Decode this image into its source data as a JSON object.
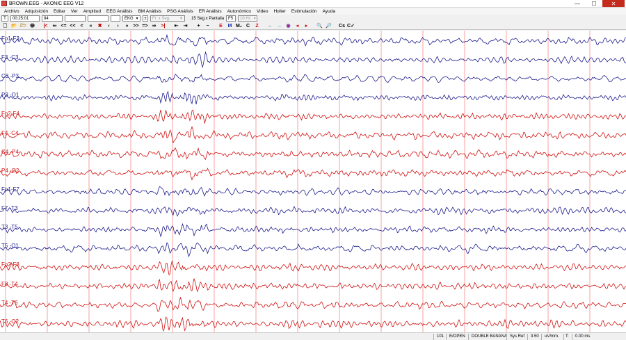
{
  "window": {
    "title": "BROWN.EEG - AKONIC EEG V12",
    "controls": {
      "minimize": "—",
      "maximize": "☐",
      "close": "✕"
    }
  },
  "menu": [
    "Archivo",
    "Adquisición",
    "Editar",
    "Ver",
    "Amplitud",
    "EEG Análisis",
    "BM Análisis",
    "PSG Análisis",
    "ER Análisis",
    "Autonómico",
    "Video",
    "Holter",
    "Estimulación",
    "Ayuda"
  ],
  "toolbar1": {
    "t_button": "T",
    "time": "00:25:01",
    "page": "84",
    "blank1": "",
    "blank2": "",
    "ekg_select": "EKG",
    "filter_select": "Fr. x Seg.",
    "seg_label": "15 Seg.x Pantalla",
    "f5": "F5",
    "hz_select": "10 Hz"
  },
  "toolbar2_icons": [
    {
      "name": "new-file-icon",
      "glyph": "🗋",
      "color": "#333"
    },
    {
      "name": "open-folder-icon",
      "glyph": "📂",
      "color": "#b08020"
    },
    {
      "name": "folder-icon",
      "glyph": "🗁",
      "color": "#b08020"
    },
    {
      "name": "print-icon",
      "glyph": "🖶",
      "color": "#333"
    },
    {
      "name": "first-page-icon",
      "glyph": "|<",
      "color": "#c00000"
    },
    {
      "name": "fast-back-icon",
      "glyph": "⇐",
      "color": "#000"
    },
    {
      "name": "back-double-icon",
      "glyph": "<=",
      "color": "#000"
    },
    {
      "name": "back-small-icon",
      "glyph": "<<",
      "color": "#000"
    },
    {
      "name": "back-icon",
      "glyph": "<",
      "color": "#000"
    },
    {
      "name": "rewind-icon",
      "glyph": "«",
      "color": "#000"
    },
    {
      "name": "cancel-icon",
      "glyph": "✖",
      "color": "#c00000"
    },
    {
      "name": "step-back-icon",
      "glyph": "‹",
      "color": "#000"
    },
    {
      "name": "step-forward-icon",
      "glyph": "›",
      "color": "#000"
    },
    {
      "name": "forward-icon",
      "glyph": "»",
      "color": "#000"
    },
    {
      "name": "forward-small-icon",
      "glyph": ">>",
      "color": "#000"
    },
    {
      "name": "forward-double-icon",
      "glyph": "=>",
      "color": "#000"
    },
    {
      "name": "fast-forward-icon",
      "glyph": "⇒",
      "color": "#000"
    },
    {
      "name": "last-page-icon",
      "glyph": ">|",
      "color": "#c00000"
    },
    {
      "name": "zoom-prev-icon",
      "glyph": "⇤",
      "color": "#000"
    },
    {
      "name": "zoom-next-icon",
      "glyph": "⇥",
      "color": "#000"
    },
    {
      "name": "plus-icon",
      "glyph": "+",
      "color": "#000"
    },
    {
      "name": "minus-icon",
      "glyph": "−",
      "color": "#000"
    },
    {
      "name": "event-e-icon",
      "glyph": "E",
      "color": "#d01010"
    },
    {
      "name": "mark-m-icon",
      "glyph": "M",
      "color": "#2030b0"
    },
    {
      "name": "montage-icon",
      "glyph": "M₂",
      "color": "#000"
    },
    {
      "name": "c-icon",
      "glyph": "C",
      "color": "#000"
    },
    {
      "name": "z-icon",
      "glyph": "Z",
      "color": "#d01010"
    },
    {
      "name": "arrow-left-icon",
      "glyph": "←",
      "color": "#2050d0"
    },
    {
      "name": "arrow-right-icon",
      "glyph": "→",
      "color": "#2050d0"
    },
    {
      "name": "target-icon",
      "glyph": "◉",
      "color": "#8030a0"
    },
    {
      "name": "red-left-icon",
      "glyph": "◂",
      "color": "#d01010"
    },
    {
      "name": "red-right-icon",
      "glyph": "▸",
      "color": "#d01010"
    },
    {
      "name": "zoom-in-icon",
      "glyph": "🔍",
      "color": "#208040"
    },
    {
      "name": "zoom-out-icon",
      "glyph": "🔎",
      "color": "#208040"
    },
    {
      "name": "cs-icon",
      "glyph": "Cs",
      "color": "#000"
    },
    {
      "name": "check-icon",
      "glyph": "C✓",
      "color": "#000"
    }
  ],
  "channels": [
    {
      "label": "Fp1-F3",
      "color": "#1a1a8c"
    },
    {
      "label": "F3 -C3",
      "color": "#1a1a8c"
    },
    {
      "label": "C3 -P3",
      "color": "#1a1a8c"
    },
    {
      "label": "P3 -O1",
      "color": "#1a1a8c"
    },
    {
      "label": "Fp2-F4",
      "color": "#d01010"
    },
    {
      "label": "F4 -C4",
      "color": "#d01010"
    },
    {
      "label": "C4 -P4",
      "color": "#d01010"
    },
    {
      "label": "P4 -O2",
      "color": "#d01010"
    },
    {
      "label": "Fp1-F7",
      "color": "#1a1a8c"
    },
    {
      "label": "F7 -T3",
      "color": "#1a1a8c"
    },
    {
      "label": "T3 -T5",
      "color": "#1a1a8c"
    },
    {
      "label": "T5 -O1",
      "color": "#1a1a8c"
    },
    {
      "label": "Fp2-F8",
      "color": "#d01010"
    },
    {
      "label": "F8 -T4",
      "color": "#d01010"
    },
    {
      "label": "T4 -T6",
      "color": "#d01010"
    },
    {
      "label": "T6 -O2",
      "color": "#d01010"
    }
  ],
  "grid_color": "#f4a0a0",
  "status": {
    "num": "101",
    "mode": "E/OPEN",
    "montage": "DOUBLE BANANA",
    "ref": "Sys Ref",
    "gain": "3.50",
    "gain_unit": "uV/mm.",
    "t_label": "T:",
    "t_value": "0.00 ms"
  }
}
